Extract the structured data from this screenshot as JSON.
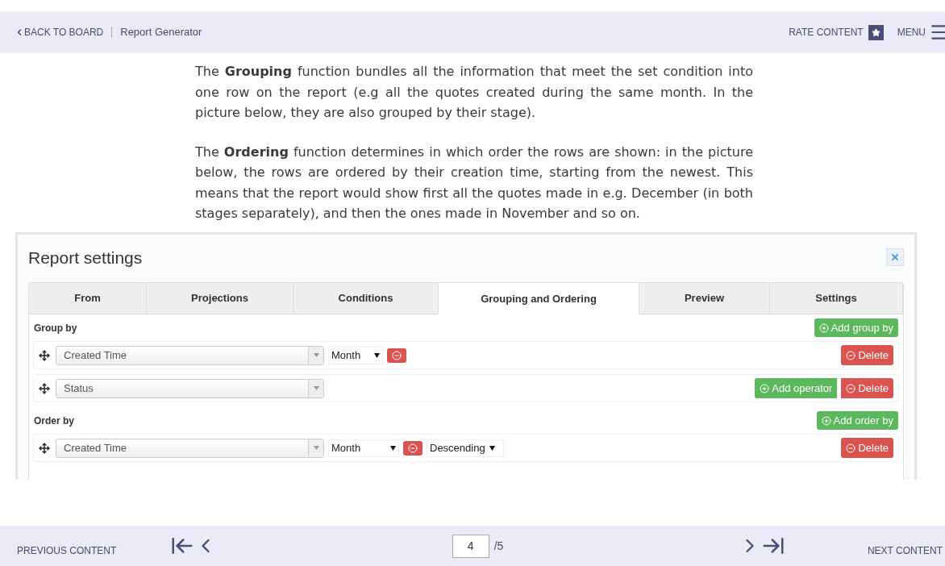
{
  "header": {
    "back": "BACK TO BOARD",
    "title": "Report Generator",
    "rate": "RATE CONTENT",
    "menu": "MENU"
  },
  "paragraphs": [
    "The **Grouping** function bundles all the information that meet the set condition into one row on the report (e.g all the quotes created during the same month. In the picture below, they are also grouped by their stage).",
    "The **Ordering** function determines in which order the rows are shown: in the picture below, the rows are ordered by their creation time, starting from the newest. This means that the report would show first all the quotes made in e.g. December (in both stages separately), and then the ones made in November and so on."
  ],
  "dialog": {
    "title": "Report settings",
    "tabs": [
      {
        "label": "From",
        "selected": false
      },
      {
        "label": "Projections",
        "selected": false
      },
      {
        "label": "Conditions",
        "selected": false
      },
      {
        "label": "Grouping and Ordering",
        "selected": true
      },
      {
        "label": "Preview",
        "selected": false
      },
      {
        "label": "Settings",
        "selected": false
      }
    ],
    "sections": [
      {
        "label": "Group by",
        "add_button": "Add group by",
        "rows": [
          {
            "field": "Created Time",
            "unit": "Month",
            "add_operator": null,
            "direction": null,
            "delete": "Delete"
          },
          {
            "field": "Status",
            "unit": null,
            "add_operator": "Add operator",
            "direction": null,
            "delete": "Delete"
          }
        ]
      },
      {
        "label": "Order by",
        "add_button": "Add order by",
        "rows": [
          {
            "field": "Created Time",
            "unit": "Month",
            "add_operator": null,
            "direction": "Descending",
            "delete": "Delete"
          }
        ]
      }
    ]
  },
  "pager": {
    "previous": "PREVIOUS CONTENT",
    "page": "4",
    "total": "/5",
    "next": "NEXT CONTENT"
  }
}
